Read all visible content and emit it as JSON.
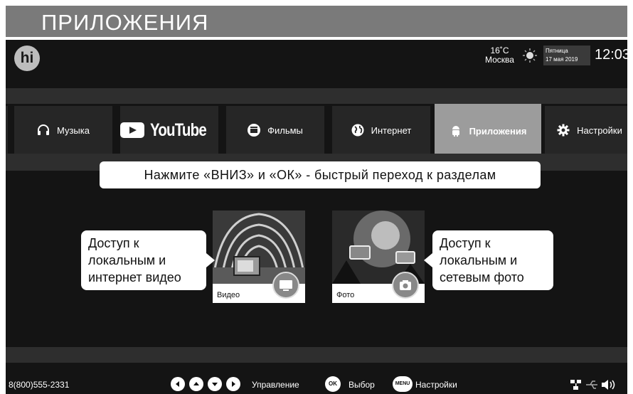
{
  "banner": {
    "title": "ПРИЛОЖЕНИЯ"
  },
  "header": {
    "logo_text": "hi",
    "weather": {
      "temp": "16˚C",
      "city": "Москва",
      "icon": "sun-icon"
    },
    "date": {
      "weekday": "Пятница",
      "date": "17 мая 2019"
    },
    "time": "12:03"
  },
  "menu": {
    "items": [
      {
        "label": "Музыка",
        "icon": "headphones-icon"
      },
      {
        "label": "YouTube",
        "icon": "youtube-play-icon"
      },
      {
        "label": "Фильмы",
        "icon": "clapper-icon"
      },
      {
        "label": "Интернет",
        "icon": "globe-icon"
      },
      {
        "label": "Приложения",
        "icon": "android-icon",
        "active": true
      },
      {
        "label": "Настройки",
        "icon": "gear-icon"
      }
    ]
  },
  "hint": "Нажмите «ВНИЗ» и «ОК» - быстрый переход к разделам",
  "cards": [
    {
      "label": "Видео",
      "icon": "tv-icon"
    },
    {
      "label": "Фото",
      "icon": "camera-icon"
    }
  ],
  "callouts": {
    "video": {
      "line1": "Доступ к",
      "line2": "локальным и",
      "line3": "интернет видео"
    },
    "photo": {
      "line1": "Доступ к",
      "line2": "локальным и",
      "line3": "сетевым фото"
    }
  },
  "footer": {
    "phone": "8(800)555-2331",
    "nav_label": "Управление",
    "ok_badge": "OK",
    "ok_label": "Выбор",
    "menu_badge": "MENU",
    "menu_label": "Настройки",
    "status_icons": [
      "network-icon",
      "usb-icon",
      "volume-icon"
    ]
  },
  "colors": {
    "active_tile": "#9c9c9c",
    "screen_bg": "#141414",
    "banner_bg": "#7a7a7a"
  }
}
